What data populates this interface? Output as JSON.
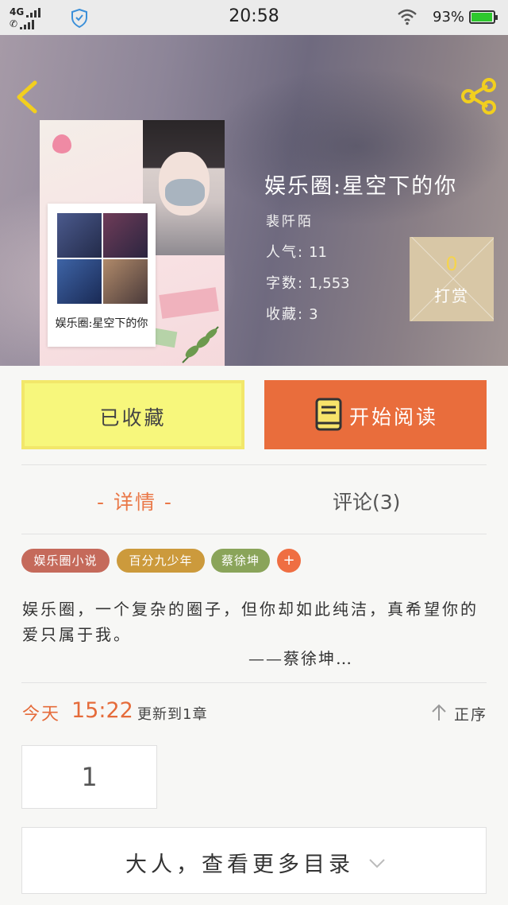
{
  "status_bar": {
    "network": "4G",
    "time": "20:58",
    "battery": "93%"
  },
  "book": {
    "title": "娱乐圈:星空下的你",
    "author": "裴阡陌",
    "cover_title": "娱乐圈:星空下的你",
    "stats": [
      {
        "label": "人气:",
        "value": "11"
      },
      {
        "label": "字数:",
        "value": "1,553"
      },
      {
        "label": "收藏:",
        "value": "3"
      }
    ],
    "tip": {
      "count": "0",
      "label": "打赏"
    }
  },
  "actions": {
    "collected": "已收藏",
    "start_reading": "开始阅读"
  },
  "tabs": {
    "detail": "- 详情 -",
    "comments": "评论(3)"
  },
  "tags": [
    "娱乐圈小说",
    "百分九少年",
    "蔡徐坤",
    "+"
  ],
  "description": {
    "text": "娱乐圈，一个复杂的圈子，但你却如此纯洁，真希望你的爱只属于我。",
    "signature": "——蔡徐坤…"
  },
  "update": {
    "day": "今天",
    "time": "15:22",
    "text": "更新到1章",
    "sort_label": "正序"
  },
  "chapters": [
    "1"
  ],
  "more_catalog": "大人，查看更多目录",
  "colors": {
    "accent_orange": "#e96d3c",
    "collected_yellow": "#f7f77c",
    "tip_gold": "#f5d44e"
  }
}
